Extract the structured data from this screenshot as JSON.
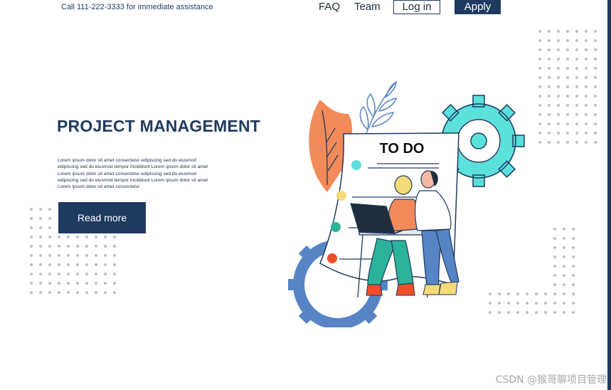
{
  "header": {
    "phone_text": "Call 111-222-3333 for immediate assistance",
    "nav": {
      "faq": "FAQ",
      "team": "Team"
    },
    "login_label": "Log in",
    "apply_label": "Apply"
  },
  "hero": {
    "title": "PROJECT MANAGEMENT",
    "body_lines": [
      "Lorem ipsum dolor sit amet consectetur edipiscing  sed do eiusmod",
      "edipiscing  sed do eiusmod tempor incididunt Lorem ipsum dolor sit amet",
      "Lorem ipsum dolor sit amet consectetur edipiscing  sed do eiusmod",
      "edipiscing  sed do eiusmod tempor incididunt Lorem ipsum dolor sit amet",
      "Lorem ipsum dolor sit amet consectetur"
    ],
    "read_more_label": "Read more"
  },
  "illustration": {
    "todo_title": "TO DO",
    "colors": {
      "navy": "#1f3a5f",
      "cyan_gear": "#5be0dc",
      "blue_gear": "#5784c4",
      "orange_leaf": "#f28a5a",
      "dot_cyan": "#5be0dc",
      "dot_yellow": "#f6d978",
      "dot_green": "#2bb39a",
      "dot_red": "#f04e2b"
    }
  },
  "watermark": "CSDN @猴哥聊项目管理"
}
